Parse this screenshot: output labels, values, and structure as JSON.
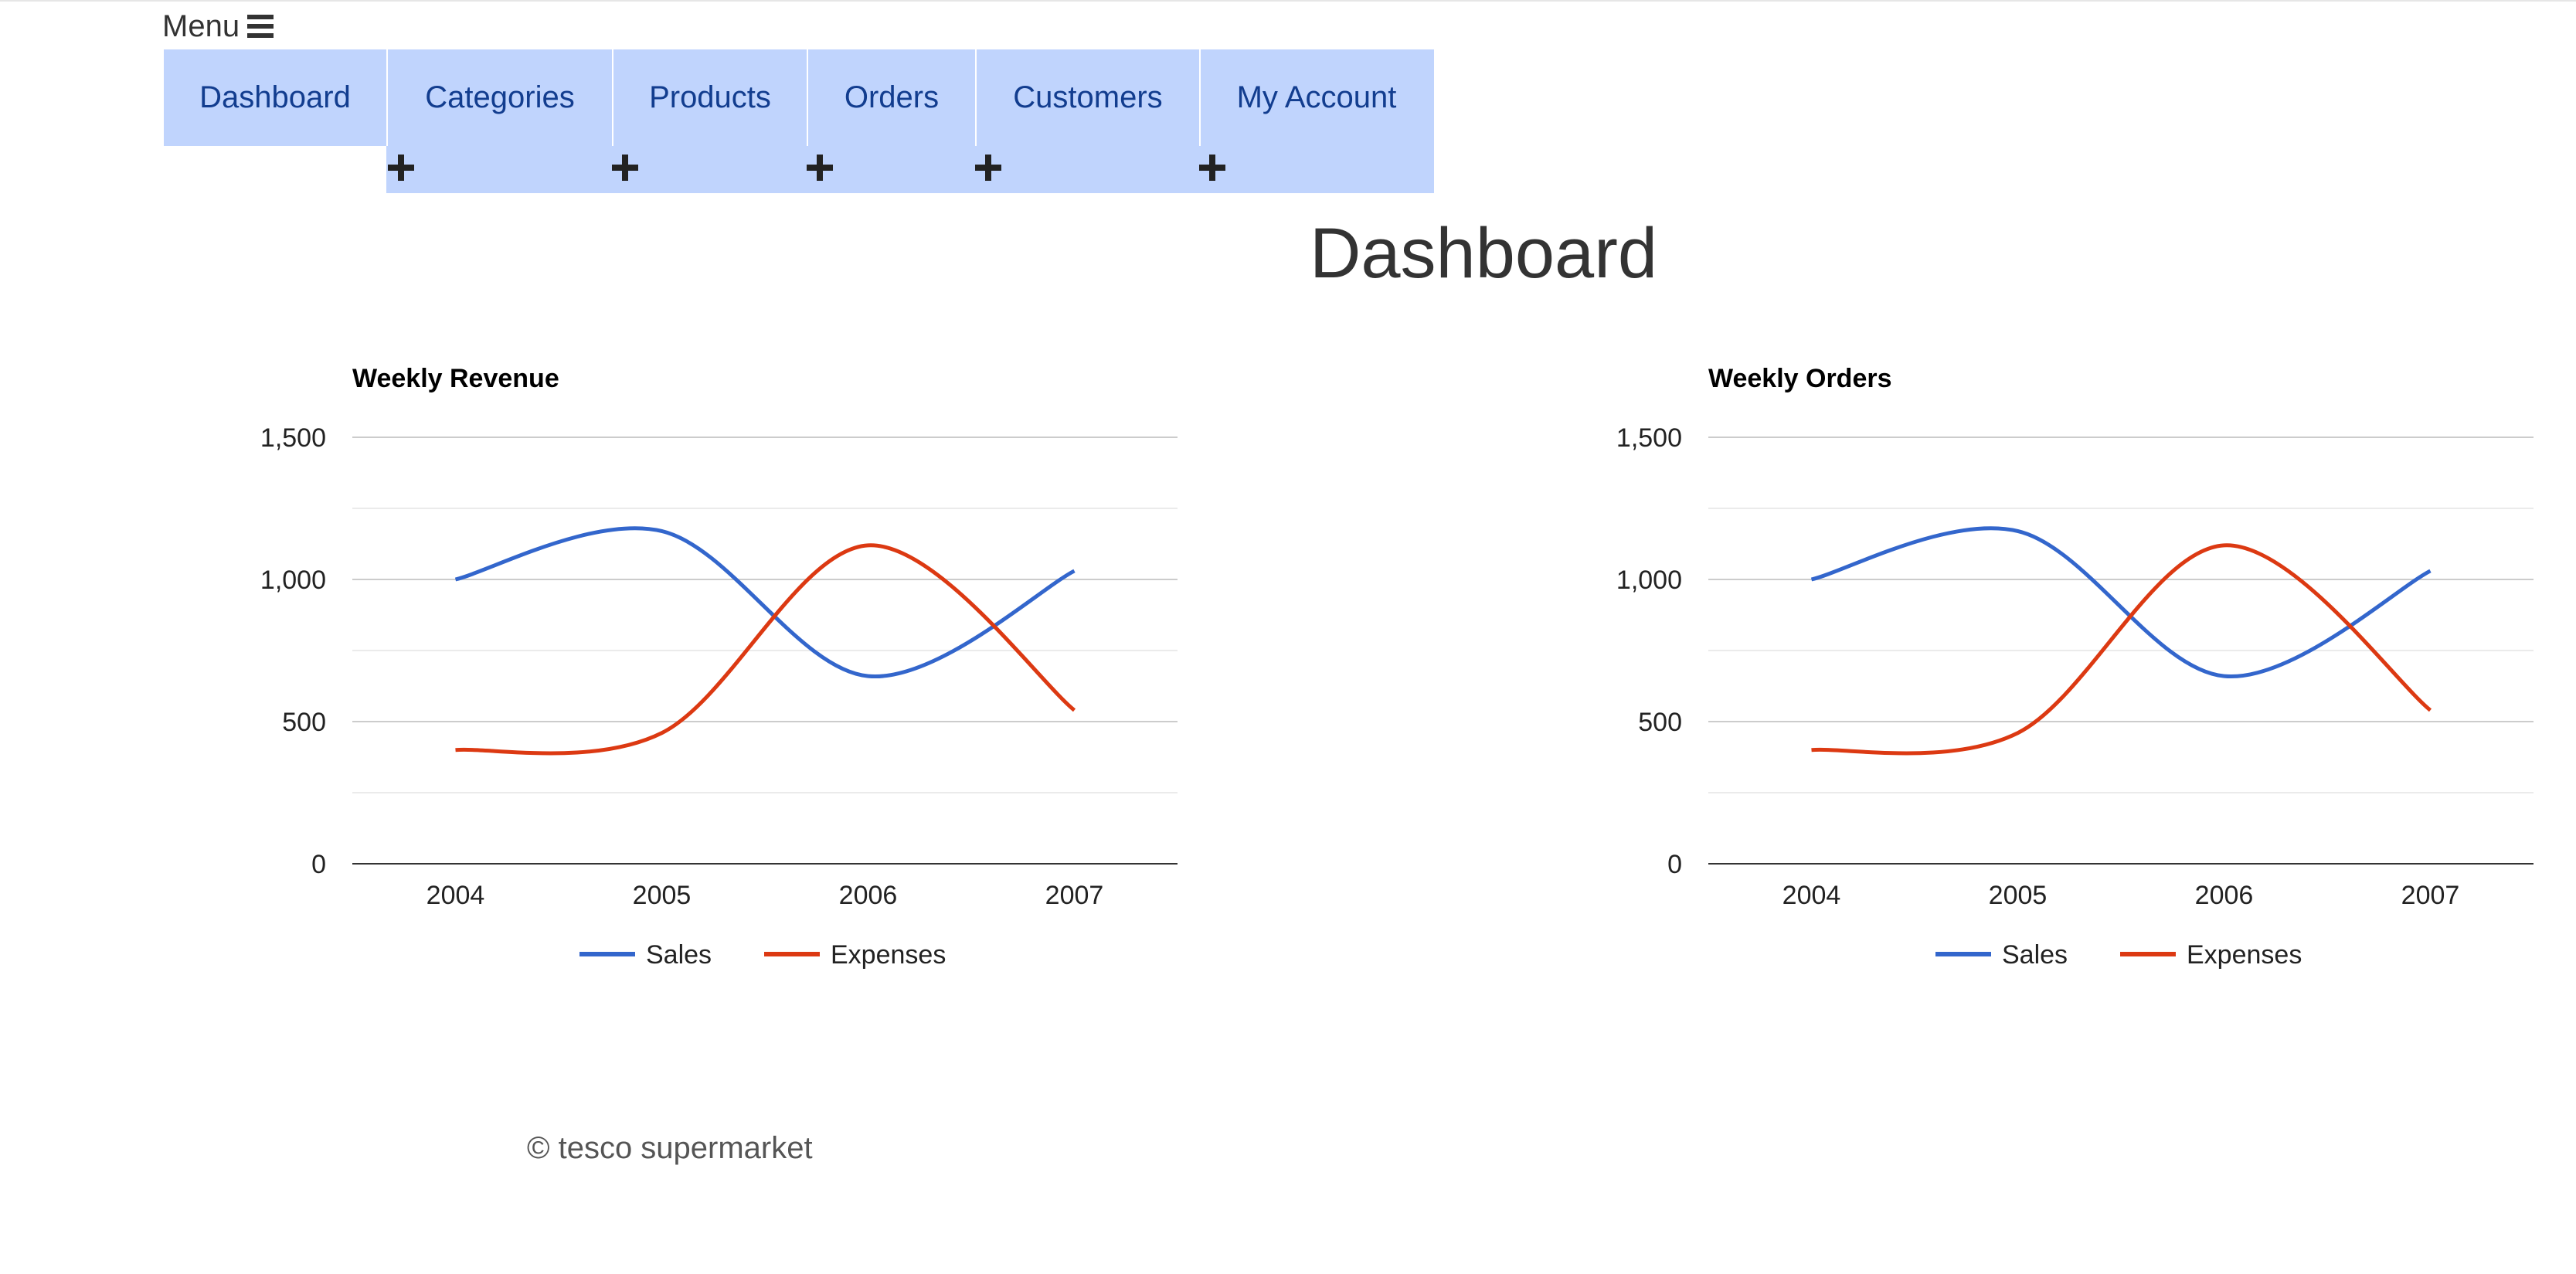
{
  "menu": {
    "label": "Menu",
    "icon": "hamburger-icon"
  },
  "nav": {
    "items": [
      {
        "label": "Dashboard"
      },
      {
        "label": "Categories"
      },
      {
        "label": "Products"
      },
      {
        "label": "Orders"
      },
      {
        "label": "Customers"
      },
      {
        "label": "My Account"
      }
    ],
    "background": "#c0d4fd",
    "link_color": "#123d8f"
  },
  "page": {
    "title": "Dashboard"
  },
  "chart_data": [
    {
      "type": "line",
      "title": "Weekly Revenue",
      "categories": [
        "2004",
        "2005",
        "2006",
        "2007"
      ],
      "series": [
        {
          "name": "Sales",
          "values": [
            1000,
            1170,
            660,
            1030
          ],
          "color": "#3366cc"
        },
        {
          "name": "Expenses",
          "values": [
            400,
            460,
            1120,
            540
          ],
          "color": "#dc3912"
        }
      ],
      "ylim": [
        0,
        1500
      ],
      "yticks": [
        "0",
        "500",
        "1,000",
        "1,500"
      ],
      "curve": "smooth",
      "grid": true,
      "legend": "bottom"
    },
    {
      "type": "line",
      "title": "Weekly Orders",
      "categories": [
        "2004",
        "2005",
        "2006",
        "2007"
      ],
      "series": [
        {
          "name": "Sales",
          "values": [
            1000,
            1170,
            660,
            1030
          ],
          "color": "#3366cc"
        },
        {
          "name": "Expenses",
          "values": [
            400,
            460,
            1120,
            540
          ],
          "color": "#dc3912"
        }
      ],
      "ylim": [
        0,
        1500
      ],
      "yticks": [
        "0",
        "500",
        "1,000",
        "1,500"
      ],
      "curve": "smooth",
      "grid": true,
      "legend": "bottom"
    }
  ],
  "footer": {
    "text": "© tesco supermarket"
  }
}
